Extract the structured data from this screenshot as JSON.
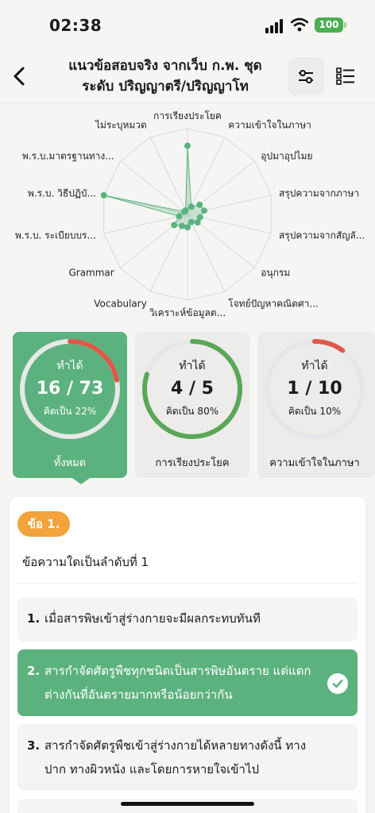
{
  "status_bar": {
    "time": "02:38",
    "battery": "100"
  },
  "header": {
    "title_line1": "แนวข้อสอบจริง จากเว็บ ก.พ. ชุด",
    "title_line2": "ระดับ ปริญญาตรี/ปริญญาโท",
    "back_icon": "chevron-left-icon",
    "filter_icon": "sliders-icon",
    "list_icon": "checklist-icon"
  },
  "radar": {
    "labels": [
      "การเรียงประโยค",
      "ความเข้าใจในภาษา",
      "อุปมาอุปไมย",
      "สรุปความจากภาษา",
      "สรุปความจากสัญลั...",
      "อนุกรม",
      "โจทย์ปัญหาคณิตศา...",
      "วิเคราะห์ข้อมูลต...",
      "Vocabulary",
      "Grammar",
      "พ.ร.บ. ระเบียบบร...",
      "พ.ร.บ. วิธีปฏิบั...",
      "พ.ร.บ.มาตรฐานทาง...",
      "ไม่ระบุหมวด"
    ],
    "values": [
      0.8,
      0.1,
      0.18,
      0.2,
      0.15,
      0.15,
      0.1,
      0.15,
      0.15,
      0.2,
      0.1,
      1.0,
      0.05,
      0.05
    ],
    "colors": {
      "fill": "#5cb27e",
      "grid": "#d9d9d9"
    }
  },
  "stats": [
    {
      "label": "ทำได้",
      "score": "16 / 73",
      "percent_text": "คิดเป็น 22%",
      "ratio": 0.22,
      "name": "ทั้งหมด",
      "active": true
    },
    {
      "label": "ทำได้",
      "score": "4 / 5",
      "percent_text": "คิดเป็น 80%",
      "ratio": 0.8,
      "name": "การเรียงประโยค",
      "active": false
    },
    {
      "label": "ทำได้",
      "score": "1 / 10",
      "percent_text": "คิดเป็น 10%",
      "ratio": 0.1,
      "name": "ความเข้าใจในภาษา",
      "active": false
    }
  ],
  "colors": {
    "accent": "#5cb27e",
    "progress_red": "#e0584a",
    "progress_green": "#5aa758",
    "badge_orange": "#f2a33a"
  },
  "question": {
    "badge": "ข้อ 1.",
    "text": "ข้อความใดเป็นลำดับที่ 1",
    "options": [
      {
        "num": "1.",
        "text": "เมื่อสารพิษเข้าสู่ร่างกายจะมีผลกระทบทันที",
        "selected": false
      },
      {
        "num": "2.",
        "text": "สารกำจัดศัตรูพืชทุกชนิดเป็นสารพิษอันตราย แต่แตกต่างกันที่อันตรายมากหรือน้อยกว่ากัน",
        "selected": true
      },
      {
        "num": "3.",
        "text": "สารกำจัดศัตรูพืชเข้าสู่ร่างกายได้หลายทางดังนี้ ทางปาก ทางผิวหนัง และโดยการหายใจเข้าไป",
        "selected": false
      }
    ]
  }
}
